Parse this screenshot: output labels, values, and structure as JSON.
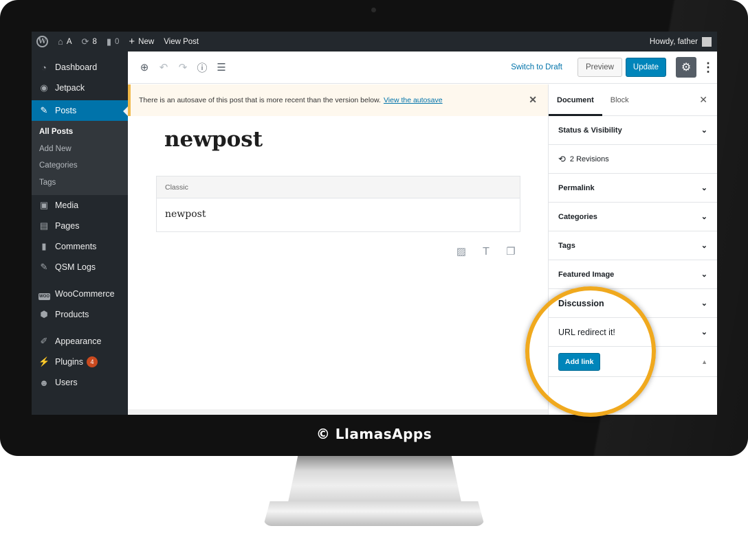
{
  "admin_bar": {
    "site_name": "A",
    "updates_count": "8",
    "comments_count": "0",
    "new_label": "New",
    "view_post_label": "View Post",
    "howdy": "Howdy, father"
  },
  "sidebar": {
    "items": [
      {
        "label": "Dashboard",
        "icon": "dashboard-icon"
      },
      {
        "label": "Jetpack",
        "icon": "jetpack-icon"
      },
      {
        "label": "Posts",
        "icon": "pin-icon"
      },
      {
        "label": "Media",
        "icon": "media-icon"
      },
      {
        "label": "Pages",
        "icon": "pages-icon"
      },
      {
        "label": "Comments",
        "icon": "comment-icon"
      },
      {
        "label": "QSM Logs",
        "icon": "pin-icon"
      },
      {
        "label": "WooCommerce",
        "icon": "woo-icon"
      },
      {
        "label": "Products",
        "icon": "products-icon"
      },
      {
        "label": "Appearance",
        "icon": "brush-icon"
      },
      {
        "label": "Plugins",
        "icon": "plug-icon",
        "badge": "4"
      },
      {
        "label": "Users",
        "icon": "users-icon"
      }
    ],
    "posts_submenu": [
      "All Posts",
      "Add New",
      "Categories",
      "Tags"
    ]
  },
  "toolbar": {
    "switch_to_draft": "Switch to Draft",
    "preview": "Preview",
    "update": "Update"
  },
  "notice": {
    "text": "There is an autosave of this post that is more recent than the version below.",
    "link": "View the autosave"
  },
  "post": {
    "title": "newpost",
    "block_label": "Classic",
    "content": "newpost"
  },
  "panel": {
    "tabs": [
      "Document",
      "Block"
    ],
    "sections": {
      "status": "Status & Visibility",
      "revisions": "2 Revisions",
      "permalink": "Permalink",
      "categories": "Categories",
      "tags": "Tags",
      "featured_image": "Featured Image",
      "discussion": "Discussion",
      "url_redirect": "URL redirect it!",
      "add_link": "Add link"
    }
  },
  "credit": "© LlamasApps",
  "colors": {
    "admin_dark": "#23282d",
    "accent_blue": "#0073aa",
    "button_blue": "#0085ba",
    "highlight_ring": "#f0a91e"
  }
}
